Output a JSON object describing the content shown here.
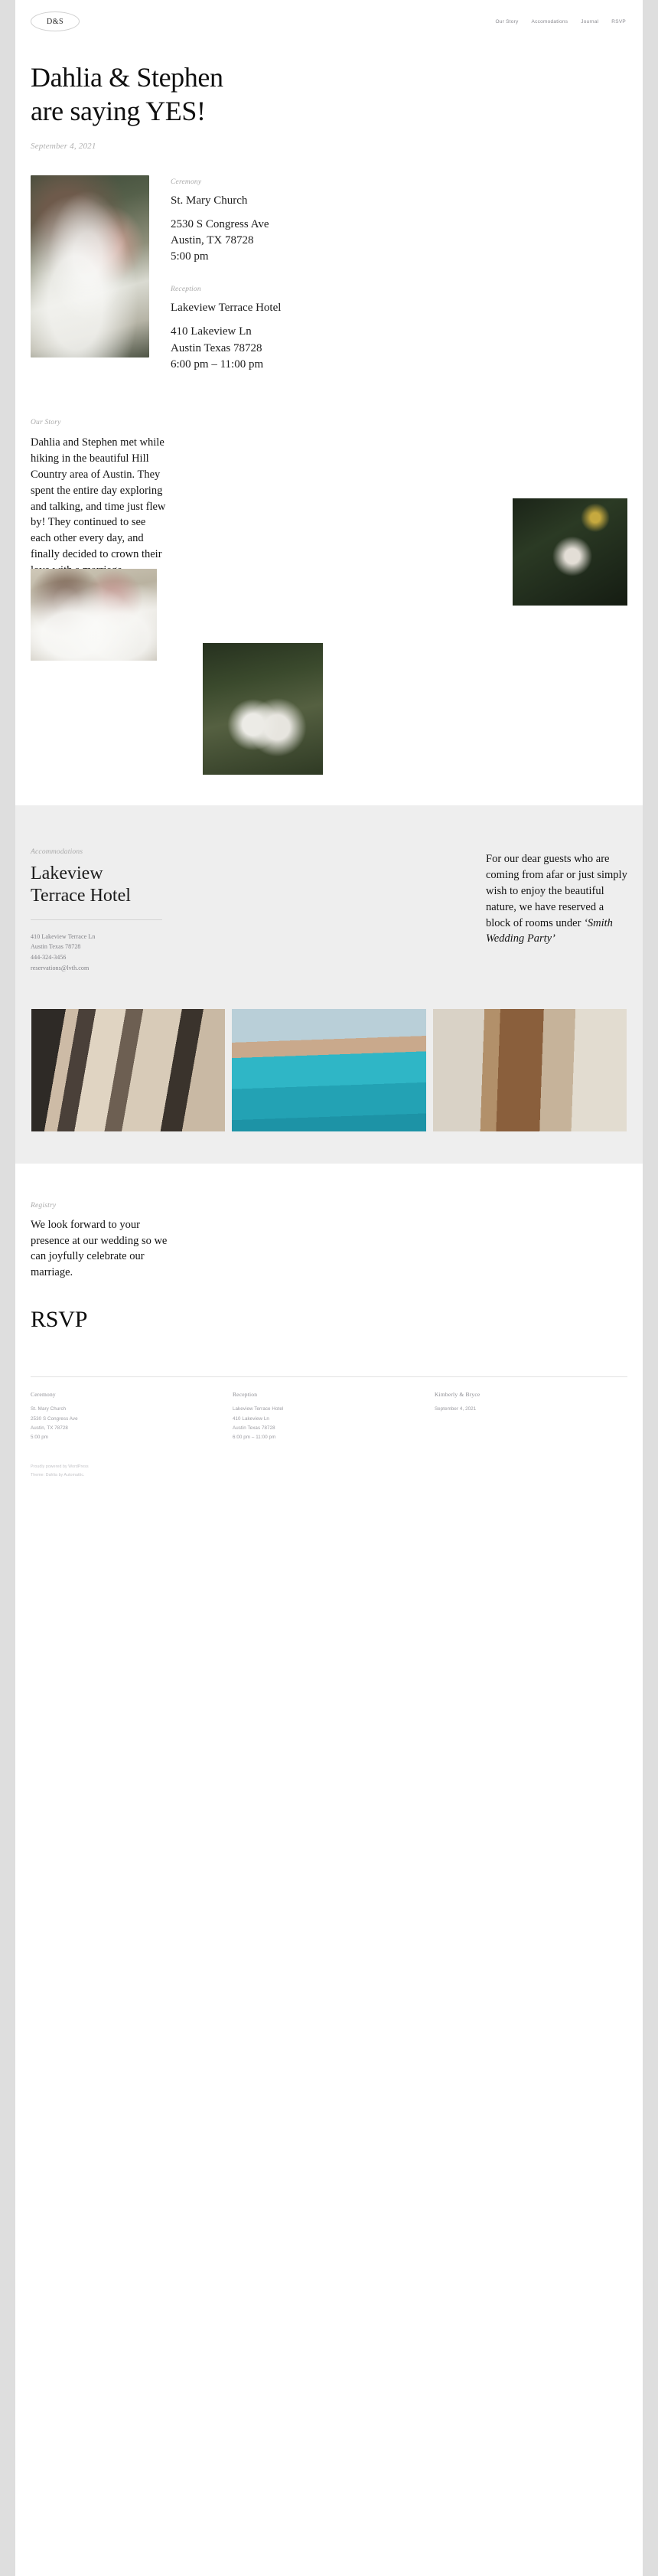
{
  "header": {
    "brand": "D&S",
    "nav": [
      {
        "label": "Our Story"
      },
      {
        "label": "Accomodations"
      },
      {
        "label": "Journal"
      },
      {
        "label": "RSVP"
      }
    ]
  },
  "hero": {
    "title_line1": "Dahlia & Stephen",
    "title_line2": "are saying YES!",
    "date": "September 4, 2021",
    "photo_alt": "couple-embracing-photo"
  },
  "events": {
    "ceremony": {
      "eyebrow": "Ceremony",
      "venue": "St. Mary Church",
      "address_line1": "2530 S Congress Ave",
      "address_line2": "Austin, TX 78728",
      "time": "5:00 pm"
    },
    "reception": {
      "eyebrow": "Reception",
      "venue": "Lakeview Terrace Hotel",
      "address_line1": "410 Lakeview Ln",
      "address_line2": "Austin Texas 78728",
      "time": "6:00 pm – 11:00 pm"
    }
  },
  "story": {
    "eyebrow": "Our Story",
    "body": "Dahlia and Stephen met while hiking in the beautiful Hill Country area of Austin. They spent the entire day exploring and talking, and time just flew by! They continued to see each other every day, and finally decided to crown their love with a marriage.",
    "photo_a_alt": "couple-walking-photo",
    "photo_b_alt": "hands-in-foliage-photo",
    "photo_c_alt": "couple-in-garden-photo"
  },
  "accommodations": {
    "eyebrow": "Accommodations",
    "hotel_name_line1": "Lakeview",
    "hotel_name_line2": "Terrace Hotel",
    "address_line1": "410 Lakeview Terrace Ln",
    "address_line2": "Austin Texas 78728",
    "phone": "444-324-3456",
    "email": "reservations@lvth.com",
    "copy_text": "For our dear guests who are coming from afar or just simply wish to enjoy the beautiful nature, we have reserved a block of rooms under ",
    "copy_emphasis": "‘Smith Wedding Party’",
    "gallery": [
      {
        "alt": "hotel-terrace-photo"
      },
      {
        "alt": "hotel-pool-photo"
      },
      {
        "alt": "hotel-doorway-photo"
      }
    ]
  },
  "registry": {
    "eyebrow": "Registry",
    "body": "We look forward to your presence at our wedding so we can joyfully celebrate our marriage.",
    "rsvp_heading": "RSVP"
  },
  "footer": {
    "columns": [
      {
        "head": "Ceremony",
        "lines": [
          "St. Mary Church",
          "2530 S Congress Ave",
          "Austin, TX 78728",
          "5:00 pm"
        ]
      },
      {
        "head": "Reception",
        "lines": [
          "Lakeview Terrace Hotel",
          "410 Lakeview Ln",
          "Austin Texas 78728",
          "6:00 pm – 11:00 pm"
        ]
      },
      {
        "head": "Kimberly & Bryce",
        "lines": [
          "September 4, 2021"
        ]
      }
    ],
    "credit_line1": "Proudly powered by WordPress",
    "credit_line2": "Theme: Dahlia by Automattic."
  },
  "colors": {
    "page_bg": "#ffffff",
    "outer_bg": "#dedede",
    "accent_gray": "#eeeeee",
    "muted_text": "#a9a9a9",
    "body_text": "#141414"
  }
}
